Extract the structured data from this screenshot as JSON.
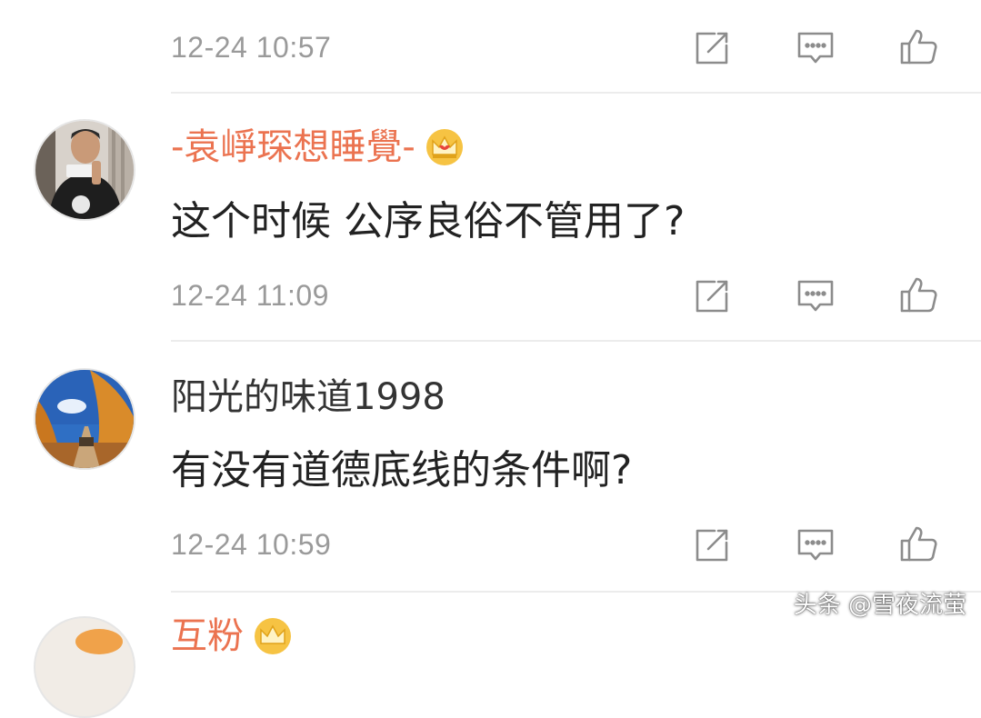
{
  "comments": [
    {
      "timestamp": "12-24 10:57"
    },
    {
      "username": "-袁崢琛想睡覺-",
      "username_color": "#eb7350",
      "badge": "crown-icon",
      "text": "这个时候 公序良俗不管用了?",
      "timestamp": "12-24 11:09"
    },
    {
      "username": "阳光的味道1998",
      "username_color": "#333333",
      "text": "有没有道德底线的条件啊?",
      "timestamp": "12-24 10:59"
    },
    {
      "username": "互粉",
      "username_color": "#eb7350",
      "badge": "crown-icon"
    }
  ],
  "actions": [
    "share-icon",
    "comment-icon",
    "like-icon"
  ],
  "colors": {
    "timestamp": "#9a9a9a",
    "divider": "#ececec",
    "icon": "#8c8c8c"
  },
  "watermark": "头条 @雪夜流萤"
}
